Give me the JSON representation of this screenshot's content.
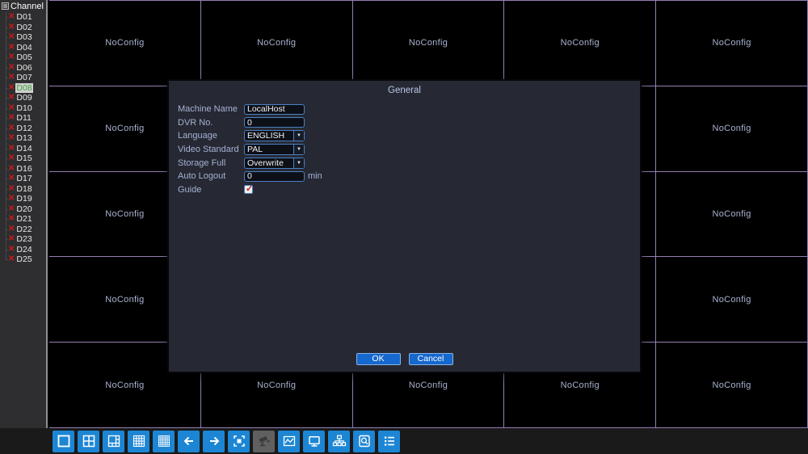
{
  "sidebar": {
    "header_label": "Channel",
    "items": [
      {
        "id": "D01"
      },
      {
        "id": "D02"
      },
      {
        "id": "D03"
      },
      {
        "id": "D04"
      },
      {
        "id": "D05"
      },
      {
        "id": "D06"
      },
      {
        "id": "D07"
      },
      {
        "id": "D08",
        "selected": true
      },
      {
        "id": "D09"
      },
      {
        "id": "D10"
      },
      {
        "id": "D11"
      },
      {
        "id": "D12"
      },
      {
        "id": "D13"
      },
      {
        "id": "D14"
      },
      {
        "id": "D15"
      },
      {
        "id": "D16"
      },
      {
        "id": "D17"
      },
      {
        "id": "D18"
      },
      {
        "id": "D19"
      },
      {
        "id": "D20"
      },
      {
        "id": "D21"
      },
      {
        "id": "D22"
      },
      {
        "id": "D23"
      },
      {
        "id": "D24"
      },
      {
        "id": "D25"
      }
    ]
  },
  "grid": {
    "rows": 5,
    "cols": 5,
    "cell_label": "NoConfig"
  },
  "dialog": {
    "title": "General",
    "fields": [
      {
        "label": "Machine Name",
        "type": "text",
        "value": "LocalHost"
      },
      {
        "label": "DVR No.",
        "type": "text",
        "value": "0"
      },
      {
        "label": "Language",
        "type": "select",
        "value": "ENGLISH"
      },
      {
        "label": "Video Standard",
        "type": "select",
        "value": "PAL"
      },
      {
        "label": "Storage Full",
        "type": "select",
        "value": "Overwrite"
      },
      {
        "label": "Auto Logout",
        "type": "text",
        "value": "0",
        "suffix": "min"
      },
      {
        "label": "Guide",
        "type": "checkbox",
        "checked": true
      }
    ],
    "buttons": {
      "ok": "OK",
      "cancel": "Cancel"
    }
  },
  "toolbar": {
    "icons": [
      {
        "name": "view-single-icon"
      },
      {
        "name": "view-quad-icon"
      },
      {
        "name": "view-eight-icon"
      },
      {
        "name": "view-sixteen-icon"
      },
      {
        "name": "view-twentyfive-icon"
      },
      {
        "name": "prev-channel-icon"
      },
      {
        "name": "next-channel-icon"
      },
      {
        "name": "fullscreen-icon"
      },
      {
        "name": "ptz-camera-icon",
        "disabled": true
      },
      {
        "name": "waveform-monitor-icon"
      },
      {
        "name": "display-monitor-icon"
      },
      {
        "name": "network-topology-icon"
      },
      {
        "name": "hdd-search-icon"
      },
      {
        "name": "channel-list-icon"
      }
    ]
  },
  "colors": {
    "accent": "#1d86d4",
    "grid_line": "#937fb4",
    "noconfig_text": "#a9b3d0",
    "offline_x": "#d01818",
    "selected_channel_text": "#3da23d",
    "selected_channel_bg": "#d0d0d0",
    "dialog_bg": "#262933",
    "input_border": "#4a80c4",
    "button_blue": "#1568cd",
    "toolbar_bg": "#1a1a1a",
    "sidebar_bg": "#2e2e30",
    "disabled_button": "#606060"
  }
}
